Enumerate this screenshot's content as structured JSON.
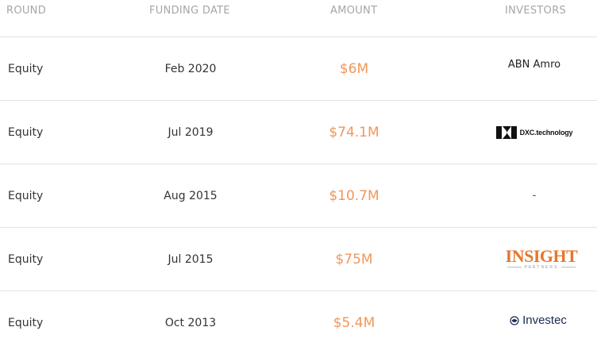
{
  "columns": {
    "round": "ROUND",
    "funding_date": "FUNDING DATE",
    "amount": "AMOUNT",
    "investors": "INVESTORS"
  },
  "rows": [
    {
      "round": "Equity",
      "date": "Feb 2020",
      "amount": "$6M",
      "investor": "ABN Amro"
    },
    {
      "round": "Equity",
      "date": "Jul 2019",
      "amount": "$74.1M",
      "investor": "DXC.technology"
    },
    {
      "round": "Equity",
      "date": "Aug 2015",
      "amount": "$10.7M",
      "investor": "-"
    },
    {
      "round": "Equity",
      "date": "Jul 2015",
      "amount": "$75M",
      "investor": "INSIGHT",
      "investor_sub": "PARTNERS"
    },
    {
      "round": "Equity",
      "date": "Oct 2013",
      "amount": "$5.4M",
      "investor": "Investec"
    }
  ],
  "colors": {
    "amount": "#f0975a",
    "header": "#a6a6a6",
    "divider": "#e3e3e3",
    "insight_brand": "#e8762c",
    "investec_brand": "#1a2a52"
  },
  "icons": {
    "dxc": "dxc-logo-icon",
    "insight": "insight-partners-logo",
    "investec": "investec-logo-icon"
  }
}
